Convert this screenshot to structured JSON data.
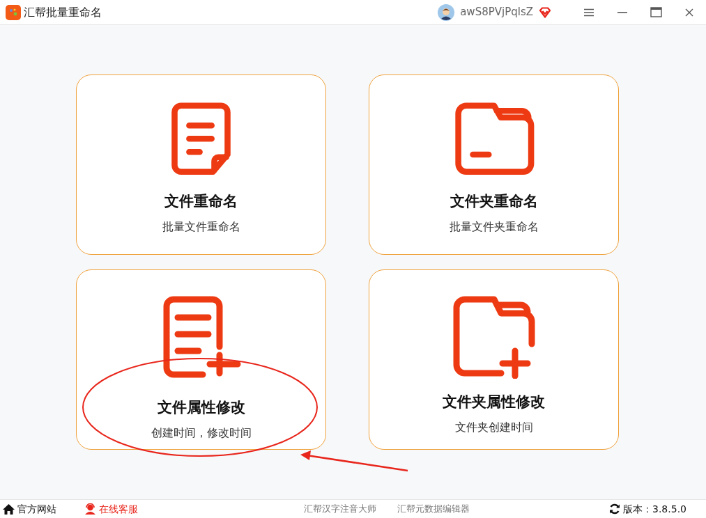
{
  "window": {
    "title": "汇帮批量重命名",
    "username": "awS8PVjPqlsZ"
  },
  "cards": [
    {
      "kind": "document",
      "title": "文件重命名",
      "subtitle": "批量文件重命名"
    },
    {
      "kind": "folder-minus",
      "title": "文件夹重命名",
      "subtitle": "批量文件夹重命名"
    },
    {
      "kind": "document-plus",
      "title": "文件属性修改",
      "subtitle": "创建时间，修改时间"
    },
    {
      "kind": "folder-plus",
      "title": "文件夹属性修改",
      "subtitle": "文件夹创建时间"
    }
  ],
  "status_bar": {
    "left": [
      {
        "kind": "home",
        "label": "官方网站"
      },
      {
        "kind": "support",
        "label": "在线客服"
      }
    ],
    "links": [
      {
        "label": "汇帮汉字注音大师"
      },
      {
        "label": "汇帮元数据编辑器"
      }
    ],
    "version": "版本：3.8.5.0"
  }
}
